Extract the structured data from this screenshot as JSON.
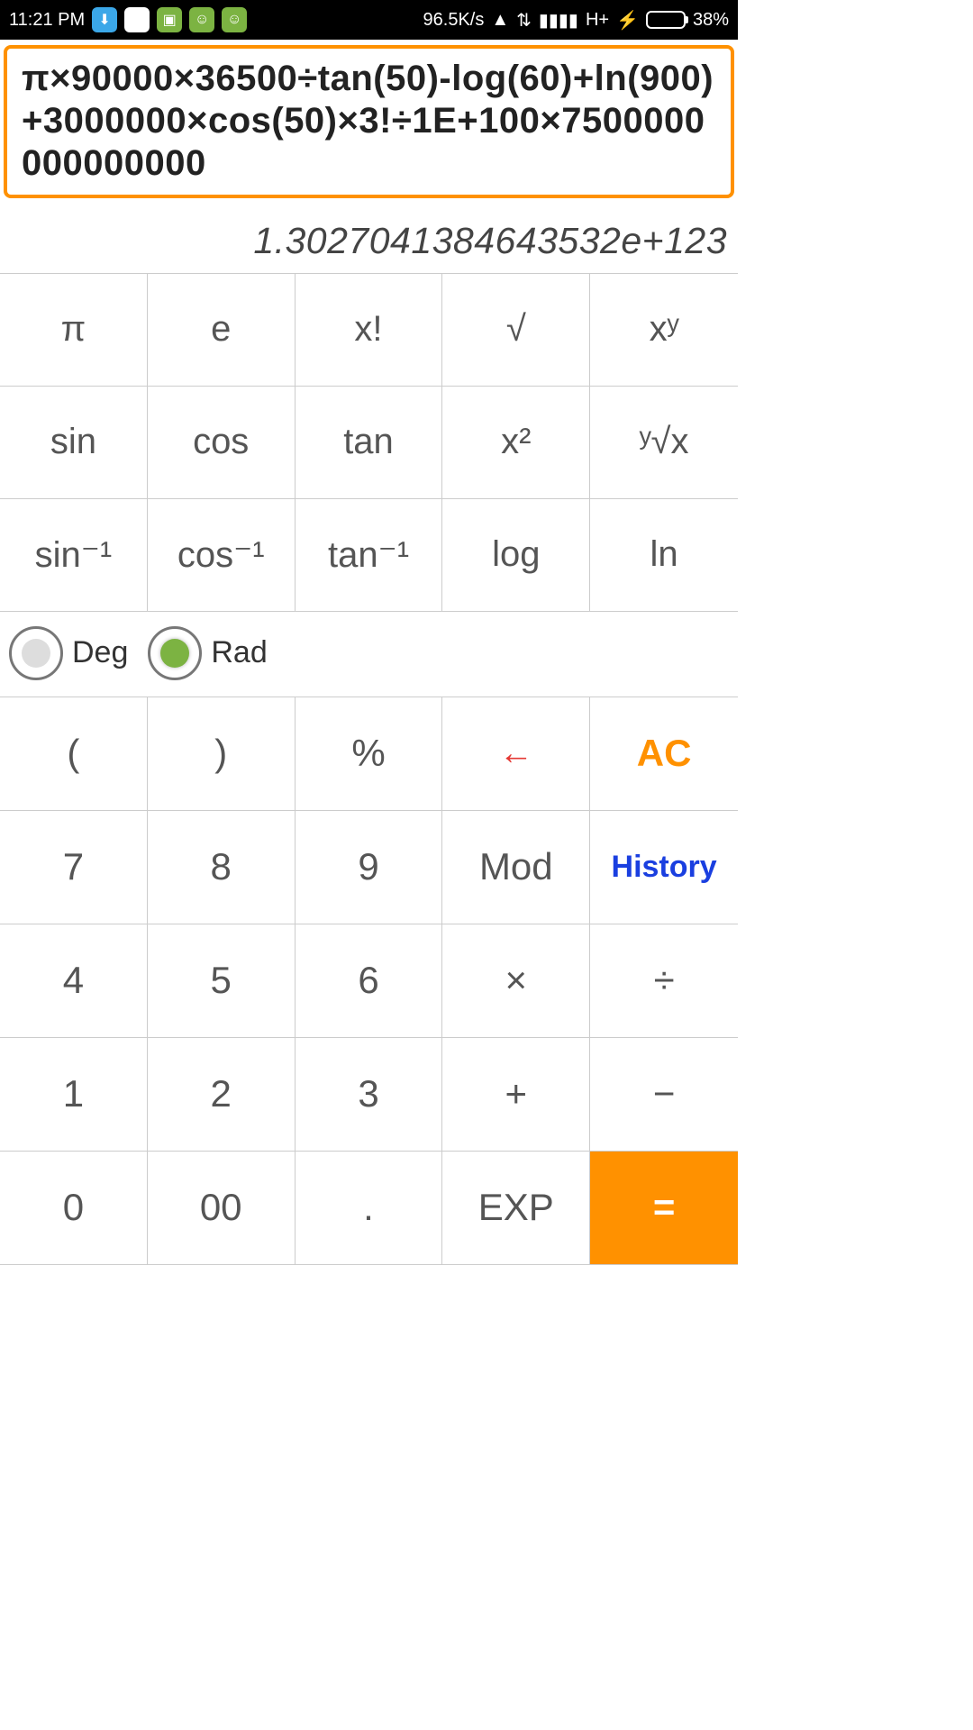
{
  "status": {
    "time": "11:21 PM",
    "net_speed": "96.5K/s",
    "net_type": "H+",
    "battery_pct": "38%"
  },
  "calc": {
    "expression": "π×90000×36500÷tan(50)-log(60)+ln(900)+3000000×cos(50)×3!÷1E+100×7500000000000000",
    "result": "1.3027041384643532e+123"
  },
  "fn": {
    "pi": "π",
    "e": "e",
    "fact": "x!",
    "sqrt": "√",
    "pow": "xʸ",
    "sin": "sin",
    "cos": "cos",
    "tan": "tan",
    "sq": "x²",
    "nroot": "ʸ√x",
    "asin": "sin⁻¹",
    "acos": "cos⁻¹",
    "atan": "tan⁻¹",
    "log": "log",
    "ln": "ln"
  },
  "mode": {
    "deg": "Deg",
    "rad": "Rad",
    "selected": "rad"
  },
  "keys": {
    "lp": "(",
    "rp": ")",
    "pct": "%",
    "back": "←",
    "ac": "AC",
    "k7": "7",
    "k8": "8",
    "k9": "9",
    "mod": "Mod",
    "hist": "History",
    "k4": "4",
    "k5": "5",
    "k6": "6",
    "mul": "×",
    "div": "÷",
    "k1": "1",
    "k2": "2",
    "k3": "3",
    "add": "+",
    "sub": "−",
    "k0": "0",
    "k00": "00",
    "dot": ".",
    "exp": "EXP",
    "eq": "="
  }
}
